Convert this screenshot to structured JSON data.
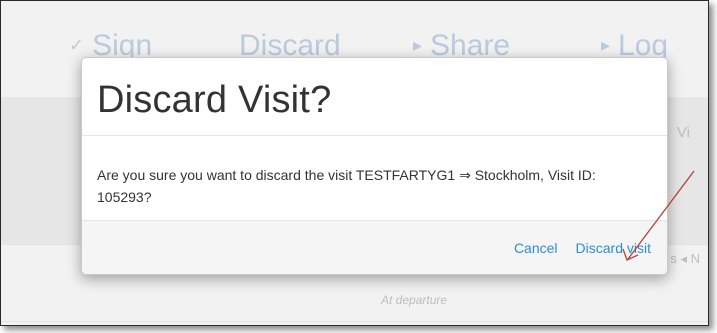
{
  "background": {
    "nav": [
      {
        "glyph": "✓",
        "label": "Sign",
        "glyph_name": "check-icon"
      },
      {
        "glyph": "",
        "label": "Discard",
        "glyph_name": ""
      },
      {
        "glyph": "▸",
        "label": "Share",
        "glyph_name": "triangle-right-icon"
      },
      {
        "glyph": "▸",
        "label": "Log",
        "glyph_name": "triangle-right-icon"
      }
    ],
    "side_text": "Vi",
    "row_text": "s  ◂ N",
    "caption": "At departure"
  },
  "dialog": {
    "title": "Discard Visit?",
    "message": "Are you sure you want to discard the visit TESTFARTYG1 ⇒ Stockholm, Visit ID: 105293?",
    "cancel_label": "Cancel",
    "discard_label": "Discard visit"
  },
  "colors": {
    "link": "#2a8ed8",
    "annotation_arrow": "#b5403a",
    "nav_faded": "#c5d6ea"
  }
}
